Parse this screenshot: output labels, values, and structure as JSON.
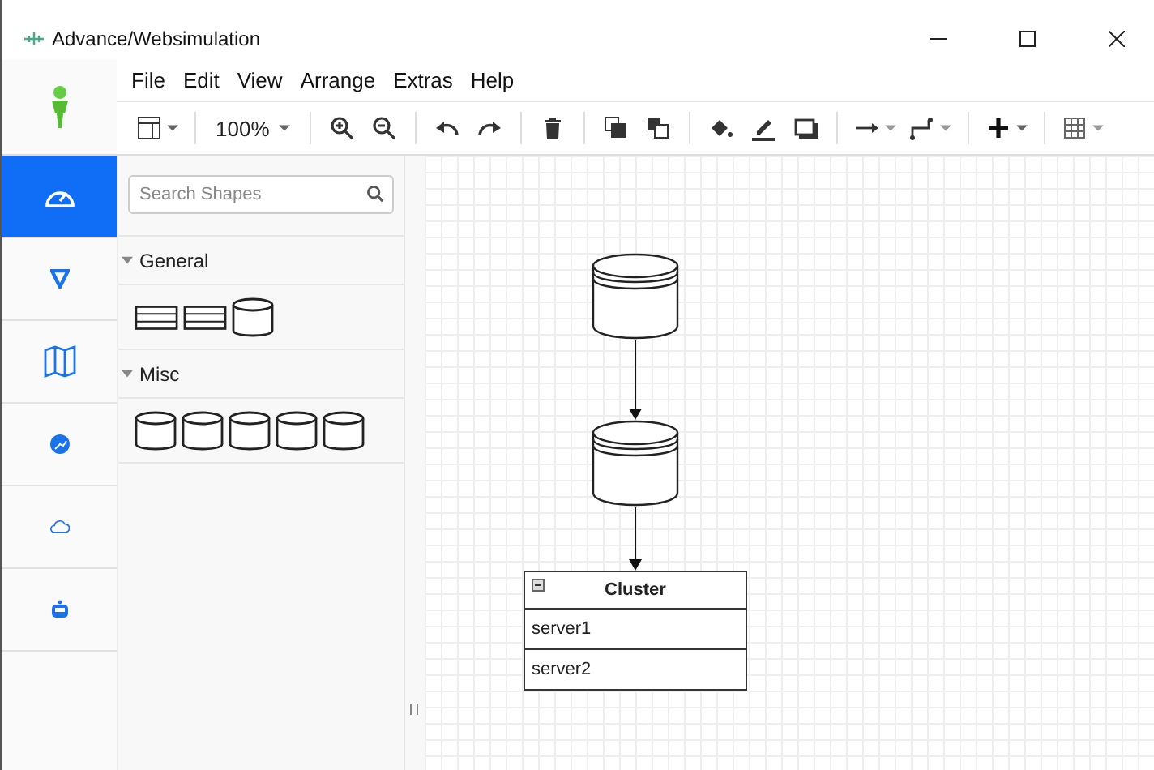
{
  "window": {
    "title": "Advance/Websimulation"
  },
  "menu": [
    "File",
    "Edit",
    "View",
    "Arrange",
    "Extras",
    "Help"
  ],
  "toolbar": {
    "zoom": "100%"
  },
  "rail": [
    {
      "kind": "gauge",
      "selected": true
    },
    {
      "kind": "triangle",
      "selected": false
    },
    {
      "kind": "map",
      "selected": false
    },
    {
      "kind": "globe",
      "selected": false
    },
    {
      "kind": "cloud",
      "selected": false
    },
    {
      "kind": "robot",
      "selected": false
    }
  ],
  "search": {
    "placeholder": "Search Shapes"
  },
  "sections": [
    {
      "title": "General",
      "expanded": true,
      "shapes": [
        {
          "kind": "table"
        },
        {
          "kind": "table"
        },
        {
          "kind": "cylinder"
        }
      ]
    },
    {
      "title": "Misc",
      "expanded": true,
      "shapes": [
        {
          "kind": "cylinder"
        },
        {
          "kind": "cylinder"
        },
        {
          "kind": "cylinder"
        },
        {
          "kind": "cylinder"
        },
        {
          "kind": "cylinder"
        }
      ]
    }
  ],
  "diagram": {
    "cylinders": [
      {
        "kind": "database"
      },
      {
        "kind": "database"
      }
    ],
    "cluster": {
      "title": "Cluster",
      "rows": [
        "server1",
        "server2"
      ]
    }
  }
}
